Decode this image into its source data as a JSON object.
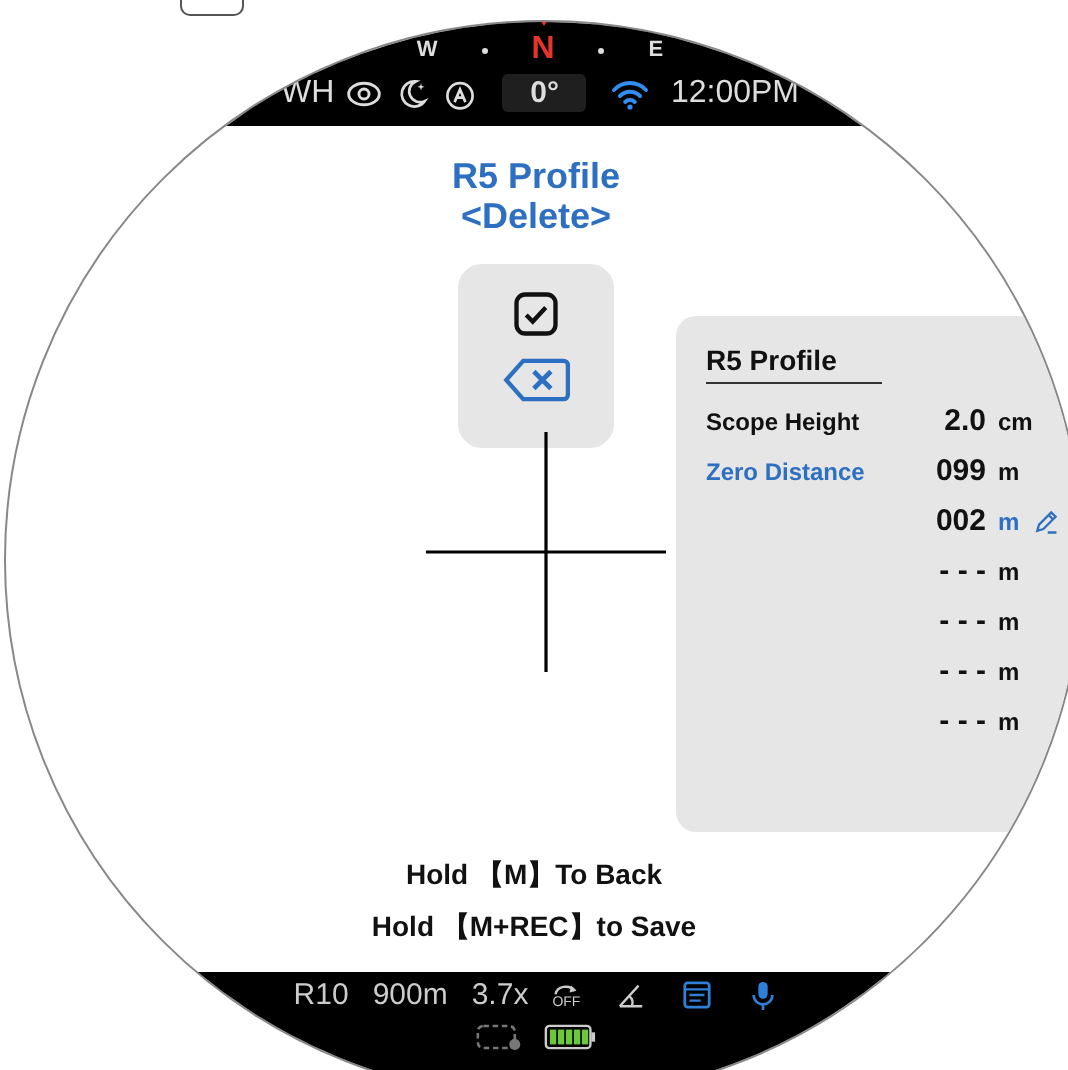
{
  "compass": [
    {
      "label": "W",
      "selected": false
    },
    {
      "label": "N",
      "selected": true
    },
    {
      "label": "E",
      "selected": false
    }
  ],
  "status_bar": {
    "mode": "WH",
    "angle": "0°",
    "time": "12:00PM"
  },
  "title": "R5 Profile",
  "subtitle": "<Delete>",
  "menu": [
    {
      "kind": "confirm",
      "selected": false
    },
    {
      "kind": "delete",
      "selected": true
    }
  ],
  "panel": {
    "title": "R5 Profile",
    "rows": [
      {
        "label": "Scope Height",
        "value": "2.0",
        "unit": "cm",
        "selected": false,
        "editing": false
      },
      {
        "label": "Zero Distance",
        "value": "099",
        "unit": "m",
        "selected": true,
        "editing": false
      },
      {
        "value": "002",
        "unit": "m",
        "editing": true
      },
      {
        "value": "- - -",
        "unit": "m",
        "editing": false
      },
      {
        "value": "- - -",
        "unit": "m",
        "editing": false
      },
      {
        "value": "- - -",
        "unit": "m",
        "editing": false
      },
      {
        "value": "- - -",
        "unit": "m",
        "editing": false
      }
    ]
  },
  "hints": [
    "Hold 【M】To Back",
    "Hold 【M+REC】to Save"
  ],
  "bottom_bar": {
    "items": [
      "R10",
      "900m",
      "3.7x"
    ],
    "rotation_label": "OFF"
  }
}
